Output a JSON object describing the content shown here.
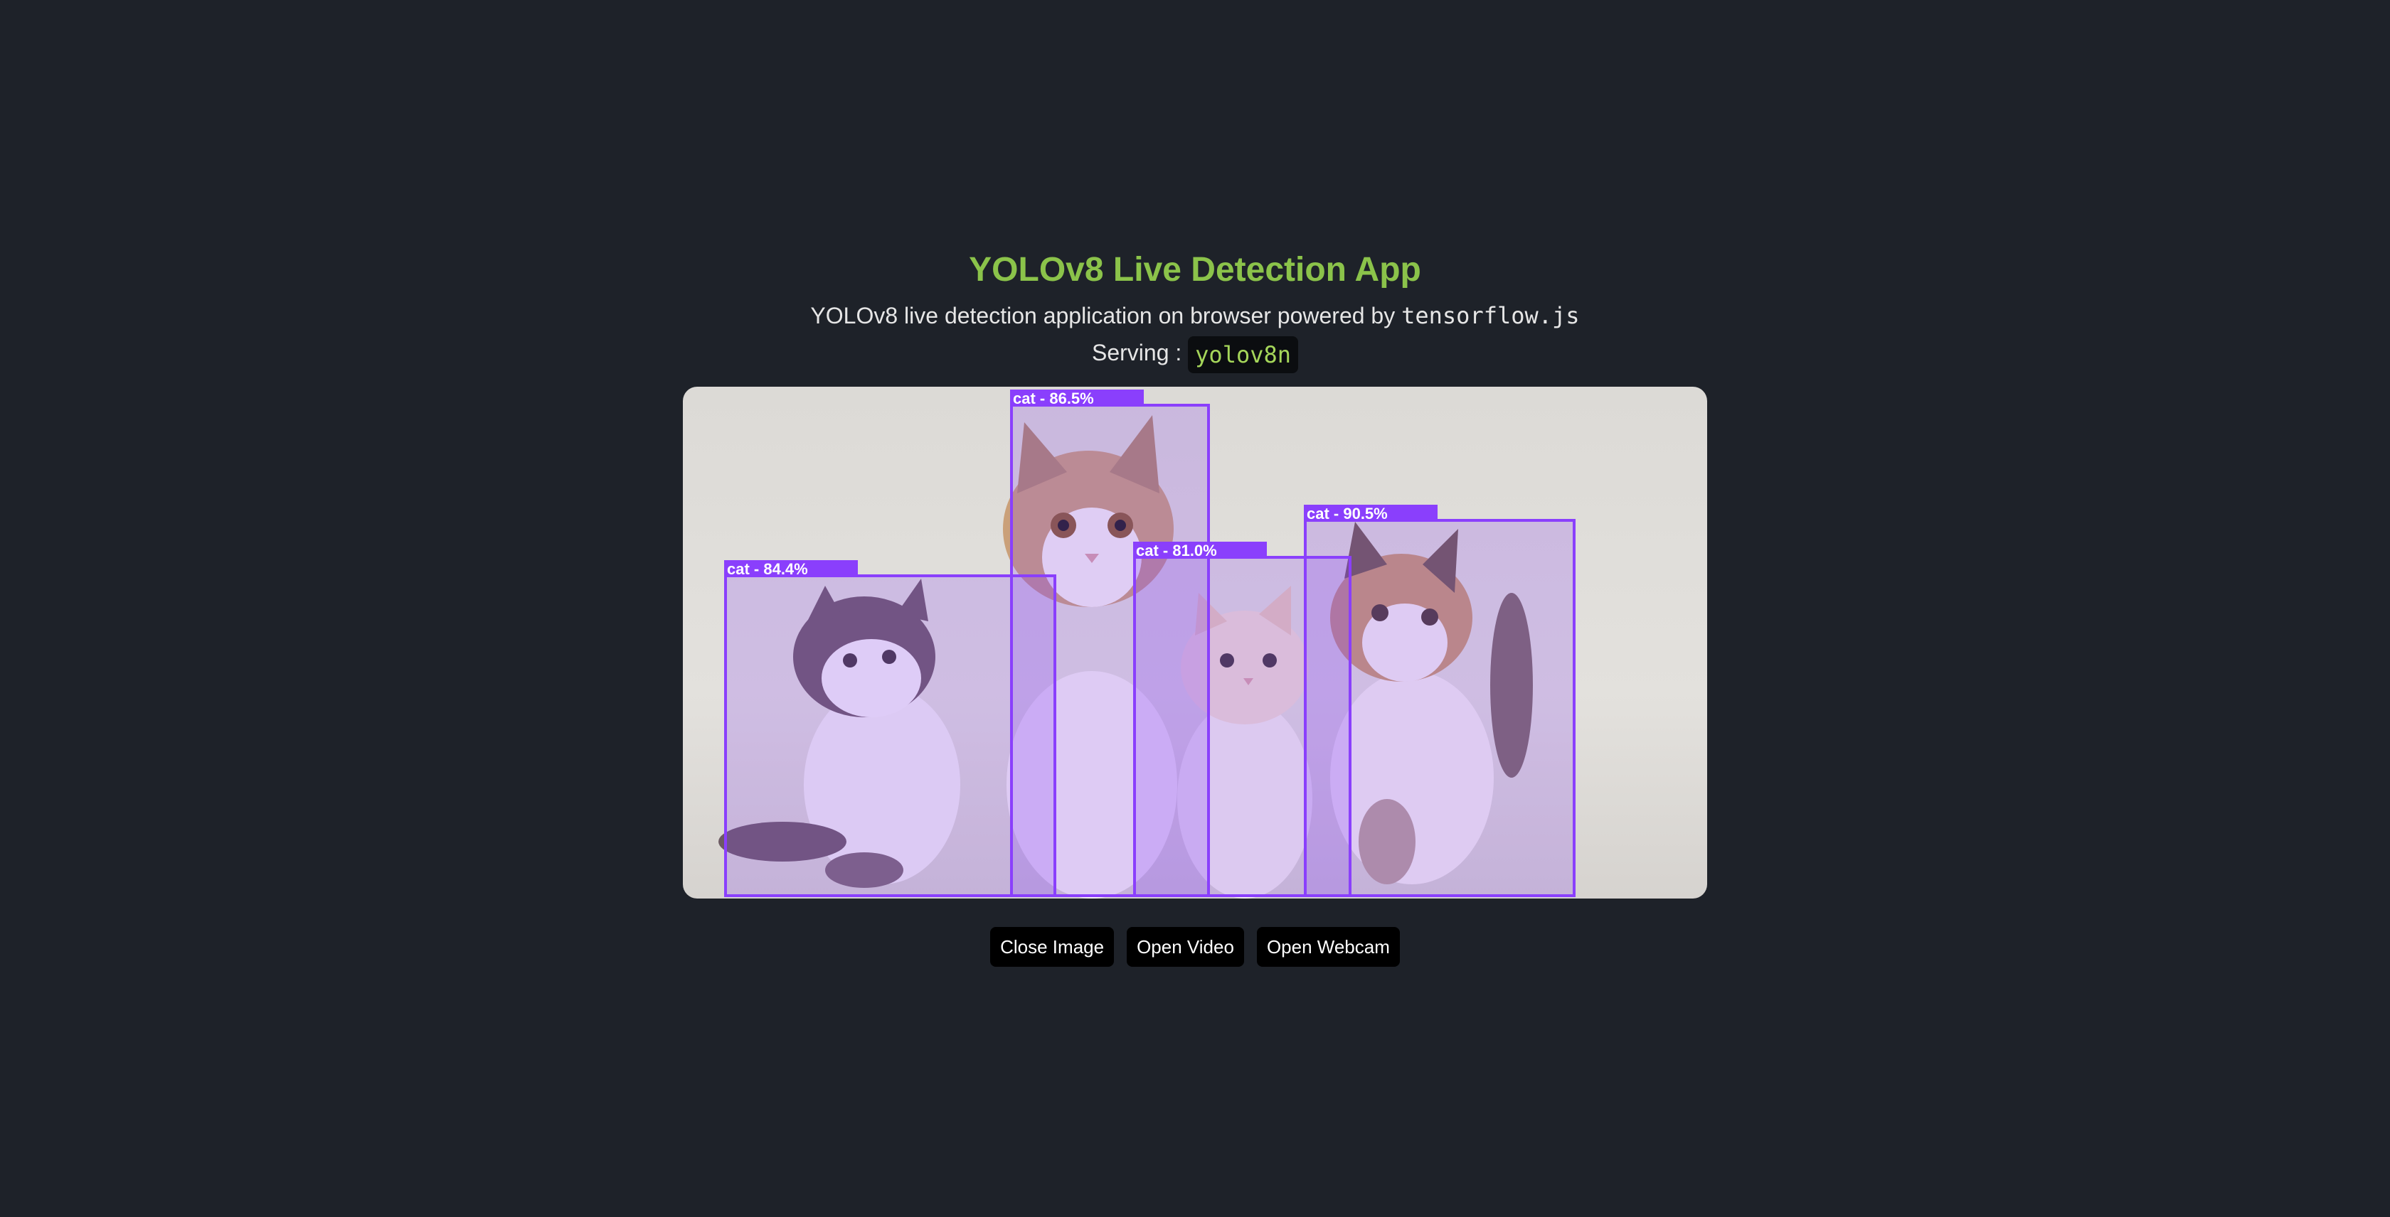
{
  "header": {
    "title": "YOLOv8 Live Detection App",
    "subtitle_prefix": "YOLOv8 live detection application on browser powered by ",
    "subtitle_code": "tensorflow.js",
    "serving_label": "Serving : ",
    "model_name": "yolov8n"
  },
  "detections": [
    {
      "label": "cat - 84.4%"
    },
    {
      "label": "cat - 86.5%"
    },
    {
      "label": "cat - 81.0%"
    },
    {
      "label": "cat - 90.5%"
    }
  ],
  "buttons": {
    "close_image": "Close Image",
    "open_video": "Open Video",
    "open_webcam": "Open Webcam"
  },
  "colors": {
    "background": "#1e2229",
    "title": "#8bc34a",
    "box": "#8a3ffc"
  }
}
